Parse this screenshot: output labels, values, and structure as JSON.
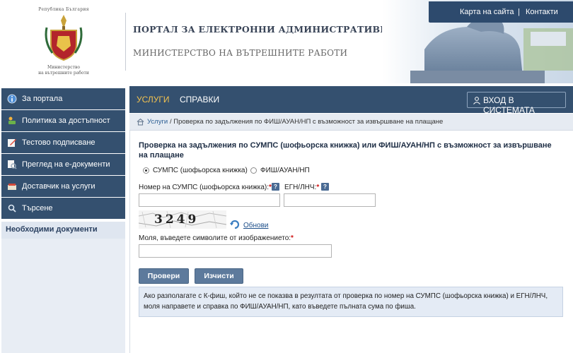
{
  "header": {
    "logo_top_text": "Република България",
    "logo_bottom_text_1": "Министерство",
    "logo_bottom_text_2": "на вътрешните работи",
    "portal_title": "ПОРТАЛ ЗА ЕЛЕКТРОННИ АДМИНИСТРАТИВНИ УСЛУГИ",
    "ministry_title": "МИНИСТЕРСТВО НА ВЪТРЕШНИТЕ РАБОТИ",
    "links": {
      "sitemap": "Карта на сайта",
      "separator": "|",
      "contacts": "Контакти"
    }
  },
  "sidebar": {
    "items": [
      {
        "label": "За портала",
        "icon": "info-icon"
      },
      {
        "label": "Политика за достъпност",
        "icon": "accessibility-icon"
      },
      {
        "label": "Тестово подписване",
        "icon": "signature-icon"
      },
      {
        "label": "Преглед на е-документи",
        "icon": "document-view-icon"
      },
      {
        "label": "Доставчик на услуги",
        "icon": "provider-icon"
      },
      {
        "label": "Търсене",
        "icon": "search-icon"
      }
    ],
    "documents_label": "Необходими документи"
  },
  "navbar": {
    "tab_services": "УСЛУГИ",
    "tab_references": "СПРАВКИ",
    "login": "ВХОД В СИСТЕМАТА",
    "active_color": "#f2c24f"
  },
  "breadcrumb": {
    "home": "Услуги",
    "current": "/ Проверка по задължения по ФИШ/АУАН/НП с възможност за извършване на плащане"
  },
  "form": {
    "title": "Проверка на задължения по СУМПС (шофьорска книжка) или ФИШ/АУАН/НП с възможност за извършване на плащане",
    "radio_options": [
      {
        "label": "СУМПС (шофьорска книжка)",
        "selected": true
      },
      {
        "label": "ФИШ/АУАН/НП",
        "selected": false
      }
    ],
    "license_label": "Номер на СУМПС (шофьорска книжка):",
    "egn_label": "ЕГН/ЛНЧ:",
    "required_mark": "*",
    "help_mark": "?",
    "license_value": "",
    "egn_value": "",
    "captcha_text": "3249",
    "refresh_label": "Обнови",
    "captcha_prompt": "Моля, въведете символите от изображението:",
    "captcha_value": "",
    "check_button": "Провери",
    "clear_button": "Изчисти",
    "info_text": "Ако разполагате с К-фиш, който не се показва в резултата от проверка по номер на СУМПС (шофьорска книжка) и ЕГН/ЛНЧ, моля направете и справка по ФИШ/АУАН/НП, като въведете пълната сума по фиша."
  },
  "colors": {
    "nav_blue": "#34506f",
    "accent_yellow": "#f2c24f",
    "info_bg": "#e4ebf5",
    "required_red": "#d01515"
  }
}
